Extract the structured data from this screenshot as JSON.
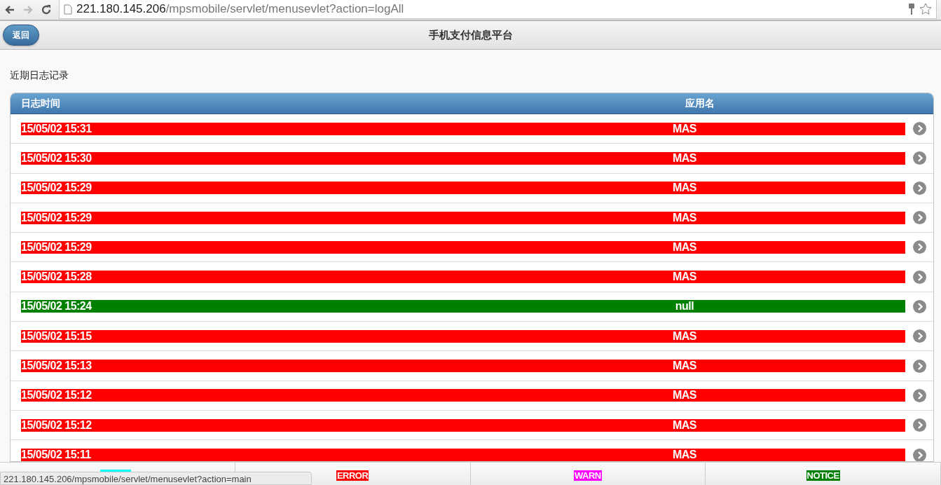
{
  "browser": {
    "url_host": "221.180.145.206",
    "url_path": "/mpsmobile/servlet/menusevlet?action=logAll"
  },
  "header": {
    "back_button": "返回",
    "title": "手机支付信息平台"
  },
  "section_title": "近期日志记录",
  "table": {
    "columns": [
      "日志时间",
      "应用名"
    ],
    "rows": [
      {
        "time": "15/05/02 15:31",
        "app": "MAS",
        "color": "#ff0000"
      },
      {
        "time": "15/05/02 15:30",
        "app": "MAS",
        "color": "#ff0000"
      },
      {
        "time": "15/05/02 15:29",
        "app": "MAS",
        "color": "#ff0000"
      },
      {
        "time": "15/05/02 15:29",
        "app": "MAS",
        "color": "#ff0000"
      },
      {
        "time": "15/05/02 15:29",
        "app": "MAS",
        "color": "#ff0000"
      },
      {
        "time": "15/05/02 15:28",
        "app": "MAS",
        "color": "#ff0000"
      },
      {
        "time": "15/05/02 15:24",
        "app": "null",
        "color": "#008000"
      },
      {
        "time": "15/05/02 15:15",
        "app": "MAS",
        "color": "#ff0000"
      },
      {
        "time": "15/05/02 15:13",
        "app": "MAS",
        "color": "#ff0000"
      },
      {
        "time": "15/05/02 15:12",
        "app": "MAS",
        "color": "#ff0000"
      },
      {
        "time": "15/05/02 15:12",
        "app": "MAS",
        "color": "#ff0000"
      },
      {
        "time": "15/05/02 15:11",
        "app": "MAS",
        "color": "#ff0000"
      }
    ]
  },
  "footer_tabs": [
    {
      "color": "#00ffff"
    },
    {
      "label": "ERROR",
      "color": "#ff0000"
    },
    {
      "label": "WARN",
      "color": "#ff00ff"
    },
    {
      "label": "NOTICE",
      "color": "#008000"
    }
  ],
  "status_bar": "221.180.145.206/mpsmobile/servlet/menusevlet?action=main"
}
